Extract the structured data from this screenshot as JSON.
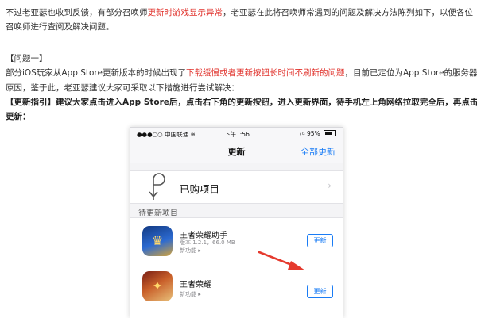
{
  "article": {
    "intro_line1_a": "不过老亚瑟也收到反馈，有部分召唤师",
    "intro_line1_red": "更新时游戏显示异常",
    "intro_line1_b": "，老亚瑟在此将召唤师常遇到的问题及解决方法陈列如下，以便各位",
    "intro_line2": "召唤师进行查阅及解决问题。",
    "problem_heading": "【问题一】",
    "p1_line1_a": "部分iOS玩家从App Store更新版本的时候出现了",
    "p1_line1_red": "下载缓慢或者更新按钮长时间不刷新的问题",
    "p1_line1_b": "，目前已定位为App Store的服务器",
    "p1_line2": "原因，鉴于此，老亚瑟建议大家可采取以下措施进行尝试解决：",
    "guide_line1": "【更新指引】建议大家点击进入App Store后，点击右下角的更新按钮，进入更新界面，待手机左上角网络拉取完全后，再点击",
    "guide_line2": "更新："
  },
  "phone": {
    "status": {
      "carrier": "中国联通",
      "time": "下午1:56",
      "battery_pct": "95%"
    },
    "nav": {
      "title": "更新",
      "update_all": "全部更新"
    },
    "purchased_label": "已购项目",
    "pending_header": "待更新项目",
    "apps": [
      {
        "name": "王者荣耀助手",
        "meta": "版本 1.2.1，66.0 MB",
        "new_features": "新功能 ▸",
        "button": "更新"
      },
      {
        "name": "王者荣耀",
        "new_features": "新功能 ▸",
        "button": "更新"
      }
    ]
  },
  "colors": {
    "accent_blue": "#1a7cf5",
    "highlight_red": "#e0302a",
    "arrow_red": "#e53a2e"
  },
  "icons": {
    "purchased": "purchased-tag-icon",
    "chevron": "chevron-right-icon",
    "wifi": "wifi-icon",
    "battery": "battery-icon",
    "alarm": "alarm-icon"
  }
}
